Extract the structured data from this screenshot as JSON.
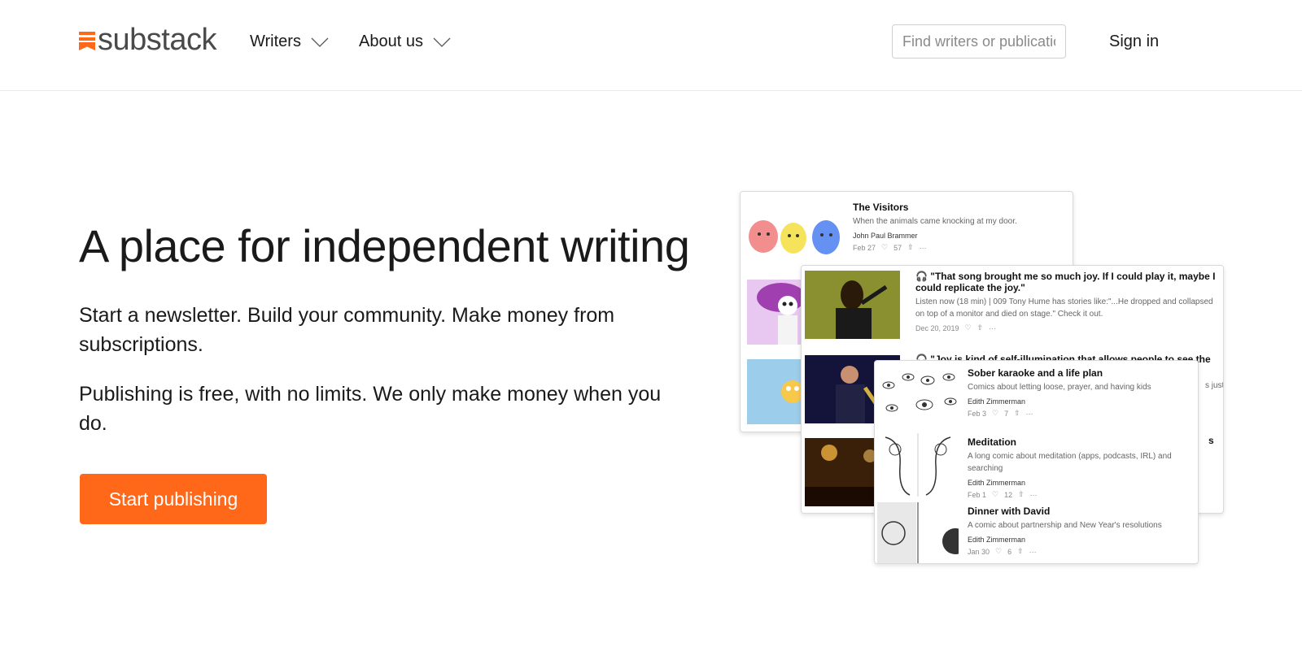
{
  "header": {
    "logo_text": "substack",
    "nav": [
      {
        "label": "Writers"
      },
      {
        "label": "About us"
      }
    ],
    "search_placeholder": "Find writers or publications",
    "signin_label": "Sign in"
  },
  "hero": {
    "title": "A place for independent writing",
    "paragraph1": "Start a newsletter. Build your community. Make money from subscriptions.",
    "paragraph2": "Publishing is free, with no limits. We only make money when you do.",
    "cta_label": "Start publishing"
  },
  "colors": {
    "brand": "#ff6719",
    "text": "#1a1a1a"
  },
  "cards": {
    "card1": {
      "post1": {
        "title": "The Visitors",
        "subtitle": "When the animals came knocking at my door.",
        "author": "John Paul Brammer",
        "date": "Feb 27",
        "likes": "57"
      }
    },
    "card2": {
      "post1": {
        "title": "🎧 \"That song brought me so much joy. If I could play it, maybe I could replicate the joy.\"",
        "subtitle": "Listen now (18 min) | 009 Tony Hume has stories like:\"...He dropped and collapsed on top of a monitor and died on stage.\" Check it out.",
        "date": "Dec 20, 2019"
      },
      "post2": {
        "title": "🎧 \"Joy is kind of self-illumination that allows people to see the",
        "subtitle_fragment": "s just",
        "title_fragment": "s"
      }
    },
    "card3": {
      "posts": [
        {
          "title": "Sober karaoke and a life plan",
          "subtitle": "Comics about letting loose, prayer, and having kids",
          "author": "Edith Zimmerman",
          "date": "Feb 3",
          "likes": "7"
        },
        {
          "title": "Meditation",
          "subtitle": "A long comic about meditation (apps, podcasts, IRL) and searching",
          "author": "Edith Zimmerman",
          "date": "Feb 1",
          "likes": "12"
        },
        {
          "title": "Dinner with David",
          "subtitle": "A comic about partnership and New Year's resolutions",
          "author": "Edith Zimmerman",
          "date": "Jan 30",
          "likes": "6"
        }
      ]
    }
  }
}
